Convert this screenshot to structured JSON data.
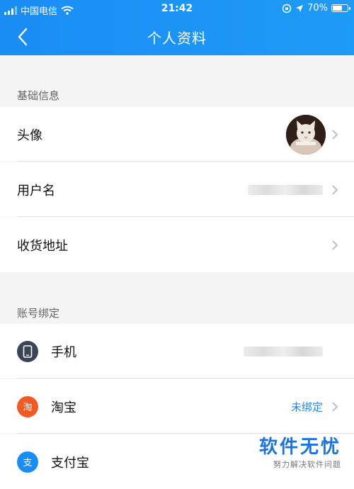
{
  "status_bar": {
    "carrier": "中国电信",
    "time": "21:42",
    "battery": "70%",
    "battery_level": 0.7
  },
  "nav": {
    "title": "个人资料"
  },
  "sections": {
    "basic_info": "基础信息",
    "account_binding": "账号绑定"
  },
  "rows": {
    "avatar": {
      "label": "头像"
    },
    "username": {
      "label": "用户名"
    },
    "address": {
      "label": "收货地址"
    },
    "phone": {
      "label": "手机"
    },
    "taobao": {
      "label": "淘宝",
      "icon_text": "淘",
      "status": "未绑定"
    },
    "alipay": {
      "label": "支付宝",
      "icon_text": "支"
    }
  },
  "watermark": {
    "title": "软件无忧",
    "subtitle": "努力解决软件问题"
  },
  "colors": {
    "header": "#1a8df5",
    "link": "#2a84d6",
    "taobao": "#f15a24",
    "alipay": "#1a8df5",
    "phone": "#3a4556"
  },
  "icons": {
    "back": "chevron-left-icon",
    "row_arrow": "chevron-right-icon",
    "phone": "phone-icon",
    "wifi": "wifi-icon",
    "location": "location-arrow-icon"
  }
}
